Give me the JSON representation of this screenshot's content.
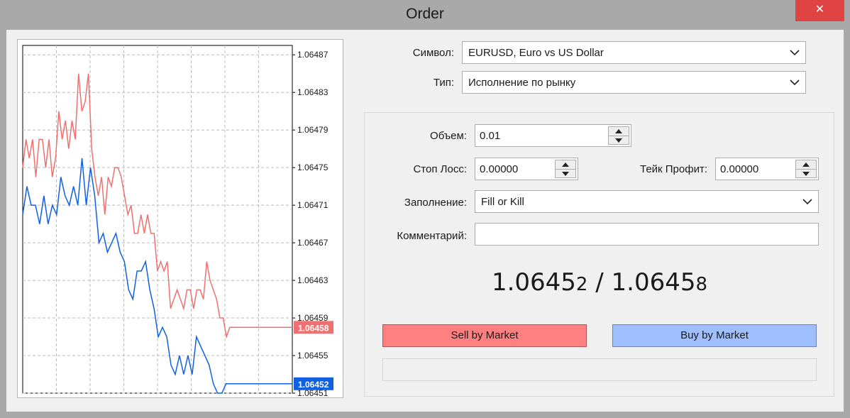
{
  "window": {
    "title": "Order",
    "close_label": "✕"
  },
  "form": {
    "symbol_label": "Символ:",
    "symbol_value": "EURUSD, Euro vs US Dollar",
    "type_label": "Тип:",
    "type_value": "Исполнение по рынку",
    "volume_label": "Объем:",
    "volume_value": "0.01",
    "sl_label": "Стоп Лосс:",
    "sl_value": "0.00000",
    "tp_label": "Тейк Профит:",
    "tp_value": "0.00000",
    "fill_label": "Заполнение:",
    "fill_value": "Fill or Kill",
    "comment_label": "Комментарий:",
    "comment_value": ""
  },
  "quote": {
    "bid_main": "1.0645",
    "bid_last": "2",
    "separator": " / ",
    "ask_main": "1.0645",
    "ask_last": "8"
  },
  "buttons": {
    "sell_label": "Sell by Market",
    "buy_label": "Buy by Market"
  },
  "colors": {
    "ask_line": "#f07070",
    "bid_line": "#1060e0",
    "sell_button": "#ff8080",
    "buy_button": "#a0bfff"
  },
  "chart_data": {
    "type": "line",
    "ylim": [
      1.06451,
      1.06488
    ],
    "y_ticks": [
      "1.06487",
      "1.06483",
      "1.06479",
      "1.06475",
      "1.06471",
      "1.06467",
      "1.06463",
      "1.06459",
      "1.06455",
      "1.06451"
    ],
    "grid": true,
    "ask_label": "1.06458",
    "bid_label": "1.06452",
    "series": [
      {
        "role": "ask",
        "values": [
          1.06475,
          1.06478,
          1.06476,
          1.06478,
          1.06474,
          1.06478,
          1.06478,
          1.06475,
          1.06478,
          1.06474,
          1.06476,
          1.06481,
          1.06478,
          1.0648,
          1.06477,
          1.0648,
          1.06478,
          1.06485,
          1.06481,
          1.06482,
          1.06485,
          1.06477,
          1.06474,
          1.06472,
          1.06474,
          1.0647,
          1.06474,
          1.06473,
          1.06475,
          1.06475,
          1.06474,
          1.06472,
          1.0647,
          1.06471,
          1.06468,
          1.06468,
          1.0647,
          1.06468,
          1.0647,
          1.06468,
          1.06468,
          1.06464,
          1.06465,
          1.06464,
          1.06465,
          1.0646,
          1.06461,
          1.06462,
          1.06461,
          1.0646,
          1.06462,
          1.06462,
          1.0646,
          1.06462,
          1.06462,
          1.06461,
          1.06465,
          1.06463,
          1.06462,
          1.06461,
          1.06459,
          1.06459,
          1.06457,
          1.06458,
          1.06458
        ]
      },
      {
        "role": "bid",
        "values": [
          1.0647,
          1.06473,
          1.06471,
          1.06471,
          1.06469,
          1.06472,
          1.06469,
          1.06471,
          1.0647,
          1.06474,
          1.06472,
          1.06471,
          1.06473,
          1.06471,
          1.06476,
          1.06471,
          1.06475,
          1.06472,
          1.06467,
          1.06468,
          1.06466,
          1.06467,
          1.06468,
          1.06466,
          1.06465,
          1.06462,
          1.06461,
          1.06464,
          1.06464,
          1.06465,
          1.06462,
          1.0646,
          1.06457,
          1.06458,
          1.06457,
          1.06454,
          1.06453,
          1.06455,
          1.06453,
          1.06455,
          1.06453,
          1.06457,
          1.06456,
          1.06455,
          1.06454,
          1.06452,
          1.06451,
          1.06451,
          1.06452,
          1.06452
        ]
      }
    ]
  }
}
